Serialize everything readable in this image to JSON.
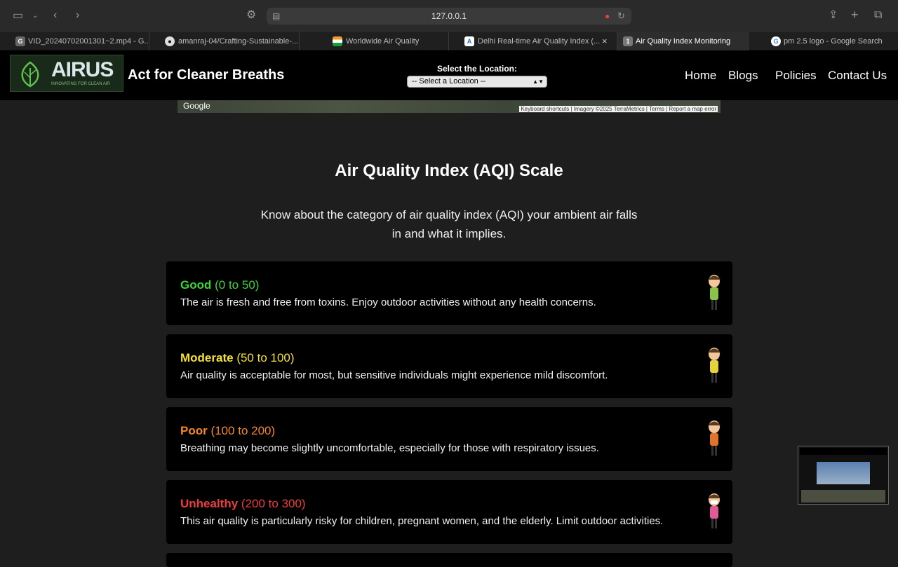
{
  "browser": {
    "url": "127.0.0.1",
    "tabs": [
      {
        "label": "VID_20240702001301~2.mp4 - G...",
        "favicon": "G"
      },
      {
        "label": "amanraj-04/Crafting-Sustainable-...",
        "favicon": "github"
      },
      {
        "label": "Worldwide Air Quality",
        "favicon": "flag"
      },
      {
        "label": "Delhi Real-time Air Quality Index (...",
        "favicon": "A"
      },
      {
        "label": "Air Quality Index Monitoring",
        "favicon": "1",
        "active": true
      },
      {
        "label": "pm 2.5 logo - Google Search",
        "favicon": "google"
      }
    ]
  },
  "header": {
    "logo_text": "AIRUS",
    "logo_tagline": "INNOVATING FOR CLEAN AIR",
    "brand": "Act for Cleaner Breaths",
    "location_label": "Select the Location:",
    "location_selected": "-- Select a Location --",
    "nav": [
      "Home",
      "Blogs",
      "Policies",
      "Contact Us"
    ]
  },
  "map": {
    "attribution": "Google",
    "links": [
      "Keyboard shortcuts",
      "Imagery ©2025 TerraMetrics",
      "Terms",
      "Report a map error"
    ]
  },
  "aqi": {
    "title": "Air Quality Index (AQI) Scale",
    "subtitle": "Know about the category of air quality index (AQI) your ambient air falls in and what it implies.",
    "categories": [
      {
        "name": "Good",
        "range": "(0 to 50)",
        "color": "#3cd63c",
        "desc": "The air is fresh and free from toxins. Enjoy outdoor activities without any health concerns."
      },
      {
        "name": "Moderate",
        "range": "(50 to 100)",
        "color": "#f5e23a",
        "desc": "Air quality is acceptable for most, but sensitive individuals might experience mild discomfort."
      },
      {
        "name": "Poor",
        "range": "(100 to 200)",
        "color": "#f5872a",
        "desc": "Breathing may become slightly uncomfortable, especially for those with respiratory issues."
      },
      {
        "name": "Unhealthy",
        "range": "(200 to 300)",
        "color": "#ef3b3b",
        "desc": "This air quality is particularly risky for children, pregnant women, and the elderly. Limit outdoor activities."
      }
    ]
  },
  "colors": {
    "accent_good": "#3cd63c",
    "accent_moderate": "#f5e23a",
    "accent_poor": "#f5872a",
    "accent_unhealthy": "#ef3b3b"
  }
}
